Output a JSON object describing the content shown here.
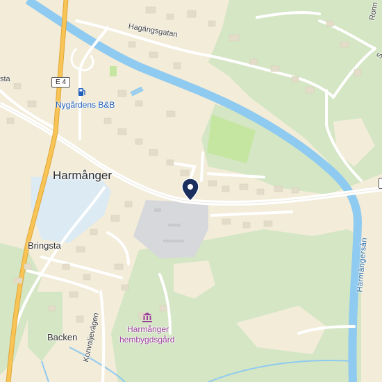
{
  "map": {
    "place_labels": {
      "harmanger": "Harmånger",
      "bringsta": "Bringsta",
      "backen": "Backen"
    },
    "street_labels": {
      "hagangsgatan": "Hagängsgatan",
      "konvaljevagen": "Konvaljevägen",
      "edge_left": "sta",
      "edge_topright": "Ronn",
      "edge_topright2": "S"
    },
    "water_labels": {
      "harmangersan": "Harmångersån"
    },
    "road_shields": {
      "e4": "E 4"
    },
    "pois": {
      "nygardens": {
        "label": "Nygårdens B&B",
        "icon": "fuel-icon",
        "color": "#1f5fbf"
      },
      "hembygdsgard": {
        "label_line1": "Harmånger",
        "label_line2": "hembygdsgård",
        "icon": "museum-icon",
        "color": "#9c3f9c"
      }
    },
    "marker": {
      "icon": "location-pin-icon",
      "color": "#1a2f5e"
    },
    "colors": {
      "land": "#f2ecd9",
      "forest": "#d4e6c4",
      "river": "#8fcaf0",
      "highway": "#f7c455",
      "road": "#ffffff",
      "parking": "#d7d8dc"
    }
  }
}
